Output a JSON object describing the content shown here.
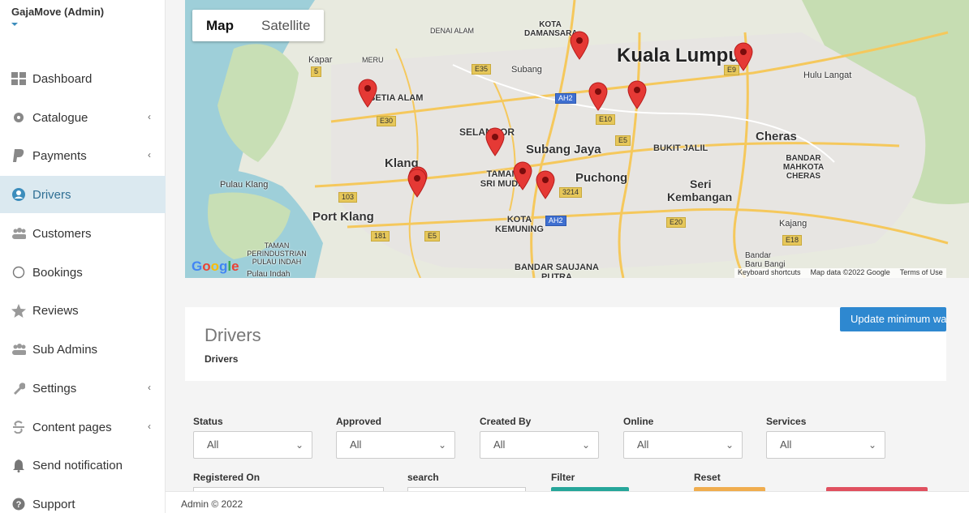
{
  "sidebar": {
    "brand": "GajaMove (Admin)",
    "items": [
      {
        "label": "Dashboard",
        "icon": "dashboard-icon",
        "has_submenu": false
      },
      {
        "label": "Catalogue",
        "icon": "gear-icon",
        "has_submenu": true
      },
      {
        "label": "Payments",
        "icon": "paypal-icon",
        "has_submenu": true
      },
      {
        "label": "Drivers",
        "icon": "user-circle-icon",
        "has_submenu": false,
        "active": true
      },
      {
        "label": "Customers",
        "icon": "users-icon",
        "has_submenu": false
      },
      {
        "label": "Bookings",
        "icon": "circle-icon",
        "has_submenu": false
      },
      {
        "label": "Reviews",
        "icon": "star-icon",
        "has_submenu": false
      },
      {
        "label": "Sub Admins",
        "icon": "users-icon",
        "has_submenu": false
      },
      {
        "label": "Settings",
        "icon": "wrench-icon",
        "has_submenu": true
      },
      {
        "label": "Content pages",
        "icon": "strikethrough-icon",
        "has_submenu": true
      },
      {
        "label": "Send notification",
        "icon": "bell-icon",
        "has_submenu": false
      },
      {
        "label": "Support",
        "icon": "question-circle-icon",
        "has_submenu": false
      }
    ],
    "chevron": "‹"
  },
  "map": {
    "toggle_map": "Map",
    "toggle_satellite": "Satellite",
    "logo": "Google",
    "attribution": [
      "Keyboard shortcuts",
      "Map data ©2022 Google",
      "Terms of Use"
    ],
    "places": {
      "kuala_lumpur": "Kuala Lumpur",
      "subang_jaya": "Subang Jaya",
      "klang": "Klang",
      "puchong": "Puchong",
      "port_klang": "Port Klang",
      "cheras": "Cheras",
      "seri_kembangan": "Seri Kembangan",
      "setia_alam": "SETIA ALAM",
      "selangor": "SELANGOR",
      "bukit_jalil": "BUKIT JALIL",
      "bandar_mahkota_cheras": "BANDAR MAHKOTA CHERAS",
      "kota_kemuning": "KOTA KEMUNING",
      "taman_sri_muda": "TAMAN SRI MUDA",
      "hulu_langat": "Hulu Langat",
      "kajang": "Kajang",
      "pulau_klang": "Pulau Klang",
      "kota_damansara": "KOTA DAMANSARA",
      "denai_alam": "DENAI ALAM",
      "subang": "Subang",
      "meru": "MERU",
      "kapar": "Kapar",
      "taman_perindustrian": "TAMAN PERINDUSTRIAN PULAU INDAH",
      "pulau_indah": "Pulau Indah",
      "bandar_saujana_putra": "BANDAR SAUJANA PUTRA",
      "bandar_baru_bangi": "Bandar Baru Bangi"
    },
    "marker_color": "#e53935",
    "marker_count": 10
  },
  "drivers_card": {
    "title": "Drivers",
    "breadcrumb": "Drivers",
    "wallet_button": "Update minimum wallet"
  },
  "filters": {
    "status": {
      "label": "Status",
      "value": "All"
    },
    "approved": {
      "label": "Approved",
      "value": "All"
    },
    "created_by": {
      "label": "Created By",
      "value": "All"
    },
    "online": {
      "label": "Online",
      "value": "All"
    },
    "services": {
      "label": "Services",
      "value": "All"
    },
    "registered_on": {
      "label": "Registered On"
    },
    "search": {
      "label": "search"
    },
    "filter": {
      "label": "Filter"
    },
    "reset": {
      "label": "Reset"
    }
  },
  "colors": {
    "accent": "#3c8dbc",
    "wallet_button": "#2e88d0",
    "filter_button": "#26a69a",
    "reset_button": "#f0ad4e",
    "danger_button": "#e0505f"
  },
  "footer": {
    "text": "Admin © 2022"
  }
}
